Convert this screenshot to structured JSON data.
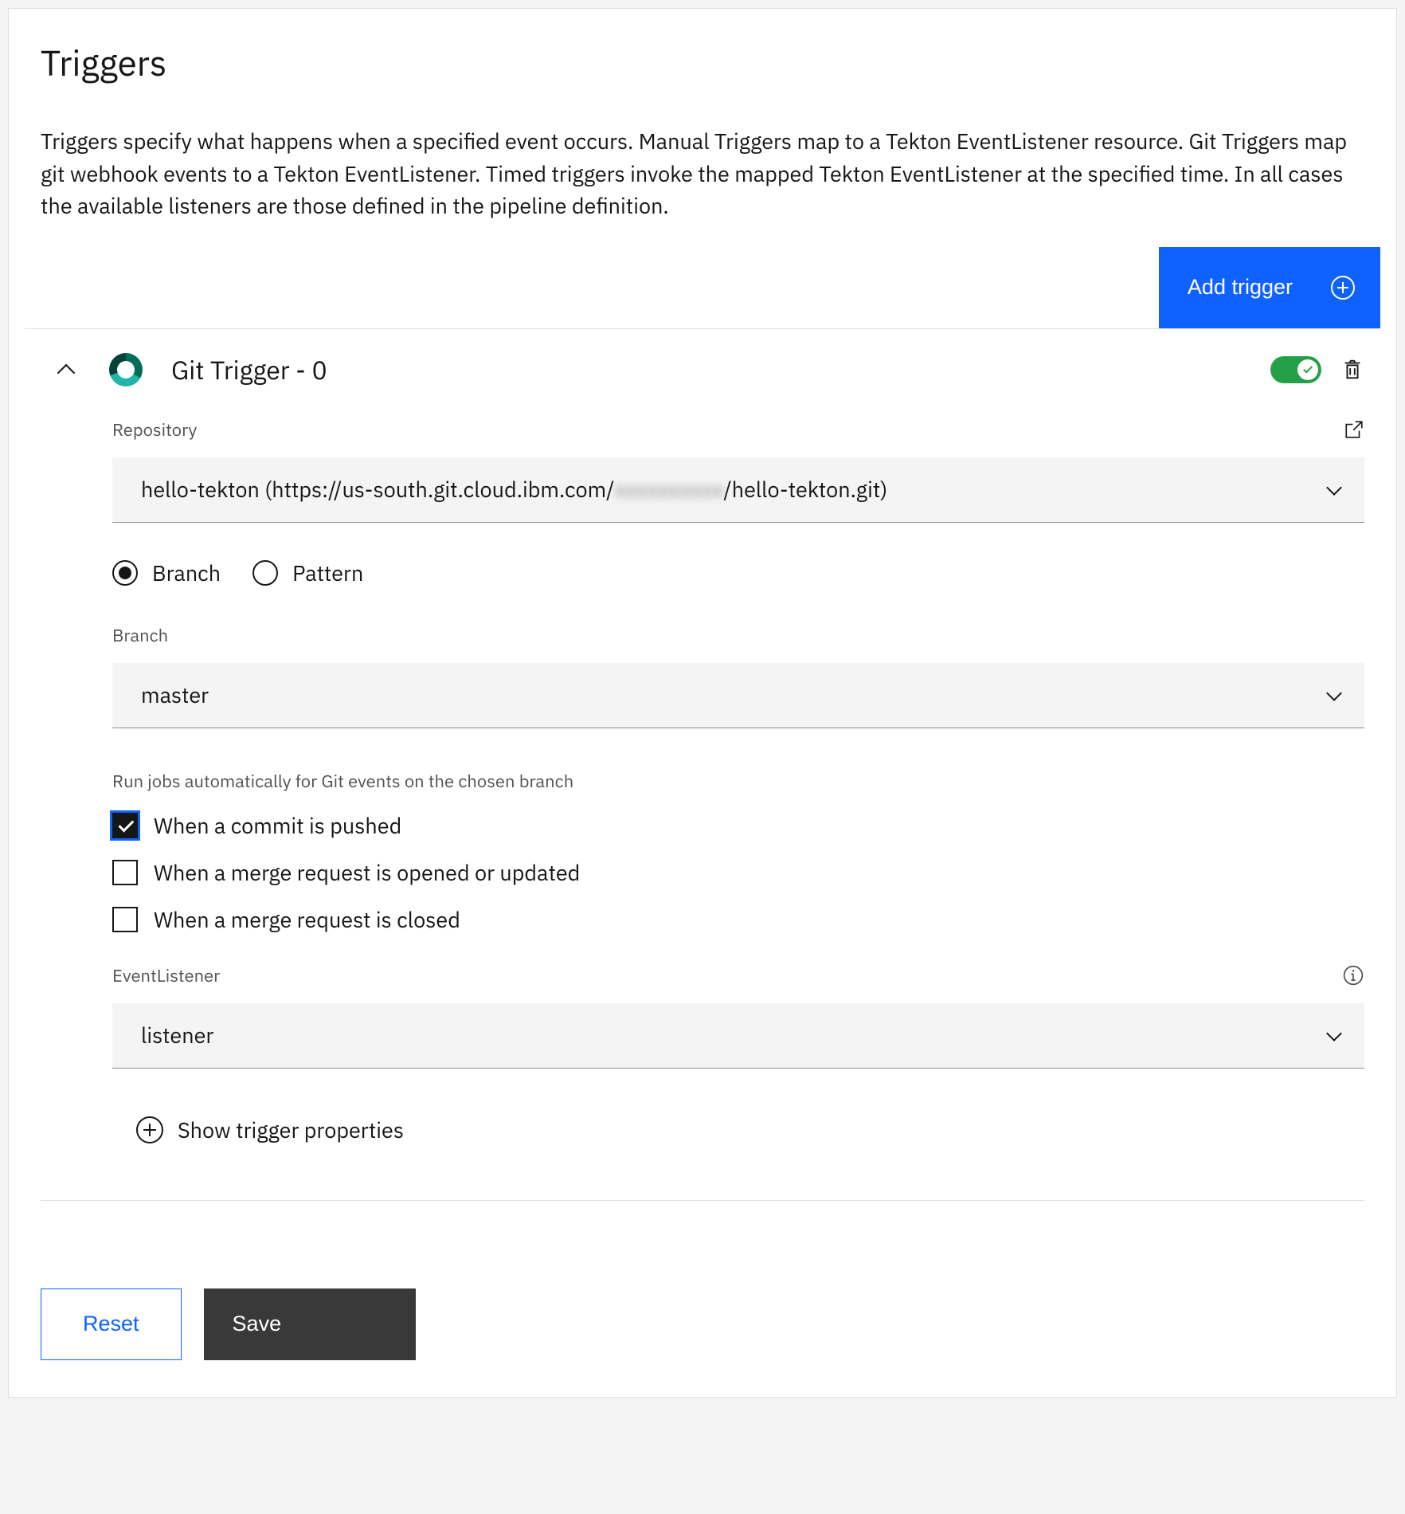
{
  "title": "Triggers",
  "description": "Triggers specify what happens when a specified event occurs. Manual Triggers map to a Tekton EventListener resource. Git Triggers map git webhook events to a Tekton EventListener. Timed triggers invoke the mapped Tekton EventListener at the specified time. In all cases the available listeners are those defined in the pipeline definition.",
  "add_trigger_label": "Add trigger",
  "trigger": {
    "name": "Git Trigger - 0",
    "enabled": true,
    "repository": {
      "label": "Repository",
      "value_prefix": "hello-tekton (https://us-south.git.cloud.ibm.com/",
      "value_blurred": "xxxxxxxxxx",
      "value_suffix": "/hello-tekton.git)"
    },
    "ref_type": {
      "options": {
        "branch": "Branch",
        "pattern": "Pattern"
      },
      "selected": "branch"
    },
    "branch": {
      "label": "Branch",
      "value": "master"
    },
    "events": {
      "help": "Run jobs automatically for Git events on the chosen branch",
      "commit_pushed": {
        "label": "When a commit is pushed",
        "checked": true
      },
      "mr_opened": {
        "label": "When a merge request is opened or updated",
        "checked": false
      },
      "mr_closed": {
        "label": "When a merge request is closed",
        "checked": false
      }
    },
    "event_listener": {
      "label": "EventListener",
      "value": "listener"
    },
    "show_properties_label": "Show trigger properties"
  },
  "footer": {
    "reset": "Reset",
    "save": "Save"
  }
}
